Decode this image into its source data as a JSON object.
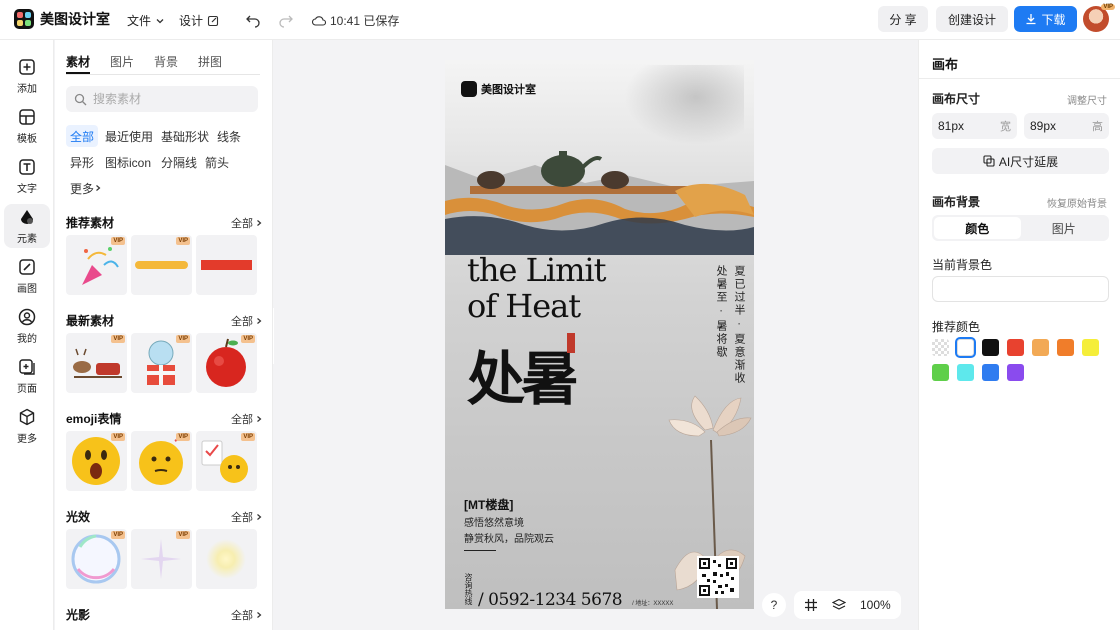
{
  "topbar": {
    "brand": "美图设计室",
    "menu": {
      "file": "文件",
      "design": "设计"
    },
    "save_status": "10:41 已保存",
    "share": "分 享",
    "create": "创建设计",
    "download": "下载",
    "avatar_badge": "VIP"
  },
  "rail": {
    "items": [
      {
        "label": "添加",
        "icon": "plus-square-icon"
      },
      {
        "label": "模板",
        "icon": "template-icon"
      },
      {
        "label": "文字",
        "icon": "text-icon"
      },
      {
        "label": "元素",
        "icon": "elements-icon"
      },
      {
        "label": "画图",
        "icon": "draw-icon"
      },
      {
        "label": "我的",
        "icon": "user-icon"
      },
      {
        "label": "页面",
        "icon": "page-add-icon"
      },
      {
        "label": "更多",
        "icon": "cube-icon"
      }
    ]
  },
  "panel": {
    "tabs": [
      "素材",
      "图片",
      "背景",
      "拼图"
    ],
    "search_placeholder": "搜索素材",
    "chips": [
      "全部",
      "最近使用",
      "基础形状",
      "线条",
      "异形",
      "图标icon",
      "分隔线",
      "箭头",
      "更多"
    ],
    "all_label": "全部",
    "vip": "VIP",
    "sections": [
      {
        "title": "推荐素材"
      },
      {
        "title": "最新素材"
      },
      {
        "title": "emoji表情"
      },
      {
        "title": "光效"
      },
      {
        "title": "光影"
      }
    ]
  },
  "poster": {
    "brand": "美图设计室",
    "title_en_line1": "the Limit",
    "title_en_line2": "of Heat",
    "title_cn": "处暑",
    "vertical_1": "处暑至 · 暑将歇",
    "vertical_2": "夏已过半 · 夏意渐收",
    "info_title": "[MT楼盘]",
    "info_line1": "感悟悠然意境",
    "info_line2": "静赏秋风，品院观云",
    "phone_label": "咨询热线",
    "phone_number": "/ 0592-1234 5678",
    "phone_addr": "/ 地址：XXXXX"
  },
  "canvas_tools": {
    "help": "?",
    "zoom": "100%"
  },
  "rpanel": {
    "title": "画布",
    "size_label": "画布尺寸",
    "size_link": "调整尺寸",
    "width_value": "81px",
    "width_unit": "宽",
    "height_value": "89px",
    "height_unit": "高",
    "ai_extend": "AI尺寸延展",
    "bg_label": "画布背景",
    "bg_reset": "恢复原始背景",
    "bg_tabs": [
      "颜色",
      "图片"
    ],
    "current_bg_label": "当前背景色",
    "recommend_label": "推荐颜色",
    "colors": [
      "transparent",
      "#ffffff",
      "#111111",
      "#e8422f",
      "#f2a955",
      "#f07d2a",
      "#f5ee3a",
      "#5fcf4a",
      "#5ee8ec",
      "#2f7cf0",
      "#8a4bee"
    ]
  }
}
